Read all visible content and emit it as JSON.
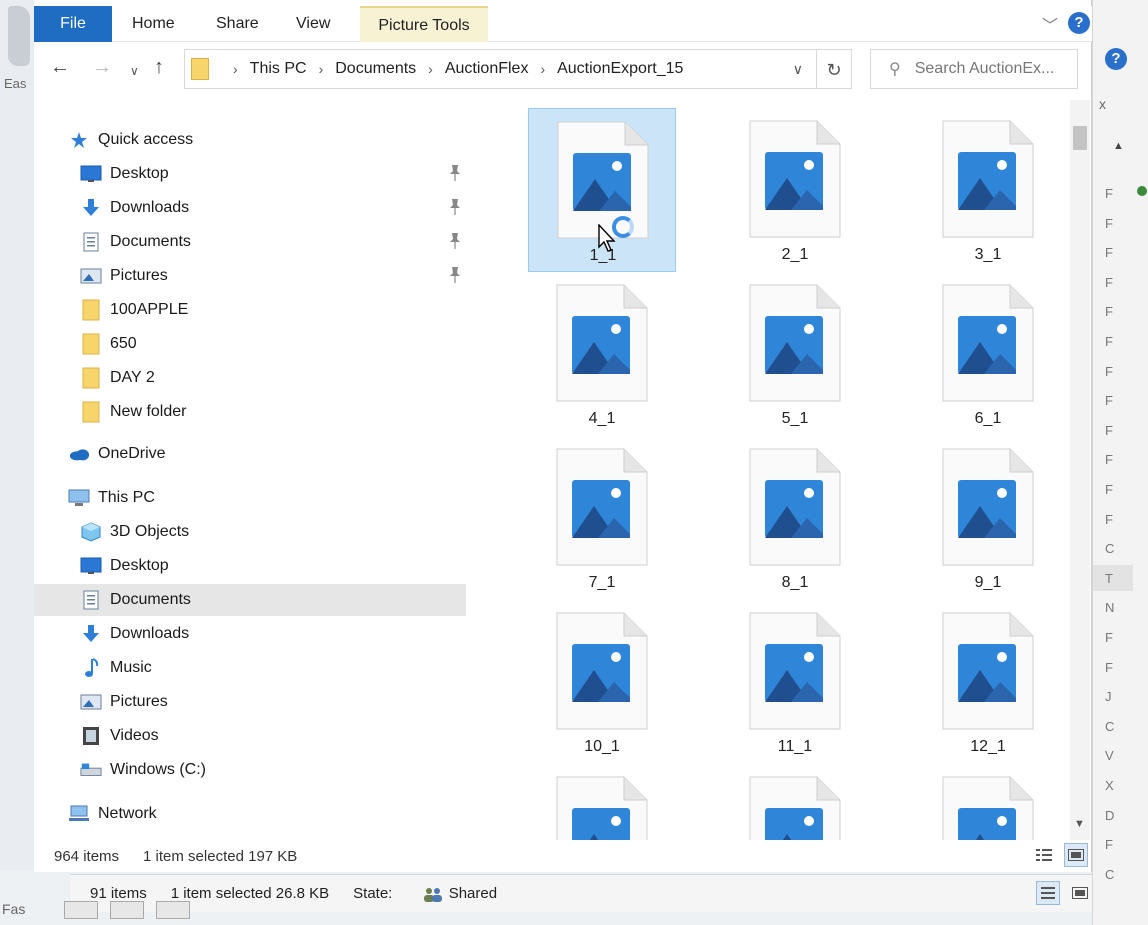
{
  "ribbon": {
    "tabs": [
      "File",
      "Home",
      "Share",
      "View",
      "Picture Tools"
    ]
  },
  "nav": {
    "breadcrumbs": [
      "This PC",
      "Documents",
      "AuctionFlex",
      "AuctionExport_15"
    ],
    "search_placeholder": "Search AuctionEx..."
  },
  "sidebar": {
    "quick_access": "Quick access",
    "quick_items": [
      {
        "label": "Desktop",
        "icon": "desktop-icon",
        "pinned": true
      },
      {
        "label": "Downloads",
        "icon": "downloads-icon",
        "pinned": true
      },
      {
        "label": "Documents",
        "icon": "documents-icon",
        "pinned": true
      },
      {
        "label": "Pictures",
        "icon": "pictures-icon",
        "pinned": true
      },
      {
        "label": "100APPLE",
        "icon": "folder-icon",
        "pinned": false
      },
      {
        "label": "650",
        "icon": "folder-icon",
        "pinned": false
      },
      {
        "label": "DAY 2",
        "icon": "folder-icon",
        "pinned": false
      },
      {
        "label": "New folder",
        "icon": "folder-icon",
        "pinned": false
      }
    ],
    "onedrive": "OneDrive",
    "this_pc": "This PC",
    "pc_items": [
      {
        "label": "3D Objects",
        "icon": "3d-objects-icon"
      },
      {
        "label": "Desktop",
        "icon": "desktop-icon"
      },
      {
        "label": "Documents",
        "icon": "documents-icon",
        "selected": true
      },
      {
        "label": "Downloads",
        "icon": "downloads-icon"
      },
      {
        "label": "Music",
        "icon": "music-icon"
      },
      {
        "label": "Pictures",
        "icon": "pictures-icon"
      },
      {
        "label": "Videos",
        "icon": "videos-icon"
      },
      {
        "label": "Windows (C:)",
        "icon": "drive-icon"
      }
    ],
    "network": "Network"
  },
  "files": [
    "1_1",
    "2_1",
    "3_1",
    "4_1",
    "5_1",
    "6_1",
    "7_1",
    "8_1",
    "9_1",
    "10_1",
    "11_1",
    "12_1",
    "",
    "",
    ""
  ],
  "selected_file": "1_1",
  "status": {
    "count": "964 items",
    "selection": "1 item selected  197 KB"
  },
  "bg_status": {
    "count": "91 items",
    "selection": "1 item selected  26.8 KB",
    "state_label": "State:",
    "state_value": "Shared"
  },
  "background": {
    "easy_text": "Eas",
    "taskbar_text": "Fas",
    "right_letters": [
      "F",
      "F",
      "F",
      "F",
      "F",
      "F",
      "F",
      "F",
      "F",
      "F",
      "F",
      "F",
      "C",
      "T",
      "N",
      "F",
      "F",
      "J",
      "C",
      "V",
      "X",
      "D",
      "F",
      "C"
    ],
    "right_x": "x"
  },
  "colors": {
    "accent": "#1f6dc2",
    "picture_tools": "#f8f2d5",
    "selection_bg": "#cce4f7",
    "folder": "#f7d56b",
    "image_sky": "#2f86d8",
    "image_mountain": "#1f4f8f"
  }
}
